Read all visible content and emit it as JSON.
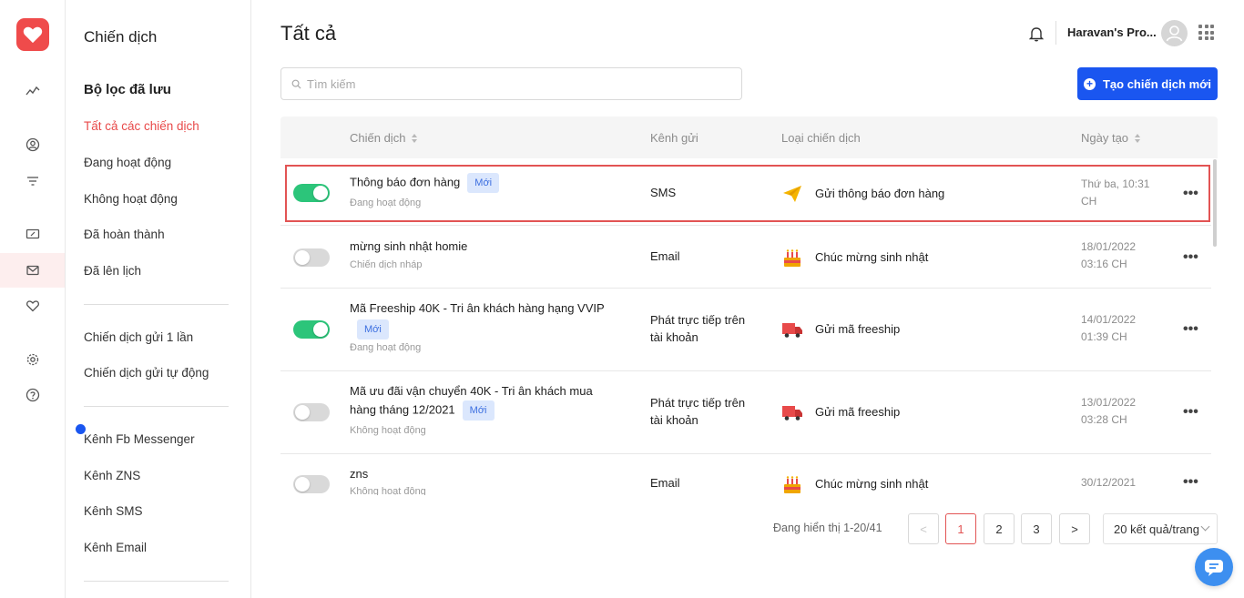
{
  "sidebar": {
    "title": "Chiến dịch",
    "saved_filters_heading": "Bộ lọc đã lưu",
    "filters": [
      "Tất cả các chiến dịch",
      "Đang hoạt động",
      "Không hoạt động",
      "Đã hoàn thành",
      "Đã lên lịch"
    ],
    "send_types": [
      "Chiến dịch gửi 1 lần",
      "Chiến dịch gửi tự động"
    ],
    "channels": [
      "Kênh Fb Messenger",
      "Kênh ZNS",
      "Kênh SMS",
      "Kênh Email"
    ]
  },
  "header": {
    "title": "Tất cả",
    "store_name": "Haravan's Pro..."
  },
  "search": {
    "placeholder": "Tìm kiếm"
  },
  "create_button": {
    "label": "Tạo chiến dịch mới"
  },
  "table": {
    "columns": [
      "Chiến dịch",
      "Kênh gửi",
      "Loại chiến dịch",
      "Ngày tạo"
    ],
    "rows": [
      {
        "name": "Thông báo đơn hàng",
        "badge": "Mới",
        "status": "Đang hoạt động",
        "enabled": true,
        "channel": "SMS",
        "type": "Gửi thông báo đơn hàng",
        "type_icon": "paper-plane-icon",
        "date_line1": "Thứ ba, 10:31",
        "date_line2": "CH"
      },
      {
        "name": "mừng sinh nhật homie",
        "badge": "",
        "status": "Chiến dịch nháp",
        "enabled": false,
        "channel": "Email",
        "type": "Chúc mừng sinh nhật",
        "type_icon": "birthday-cake-icon",
        "date_line1": "18/01/2022",
        "date_line2": "03:16 CH"
      },
      {
        "name": "Mã Freeship 40K - Tri ân khách hàng hạng VVIP",
        "badge": "Mới",
        "status": "Đang hoạt động",
        "enabled": true,
        "channel": "Phát trực tiếp trên tài khoản",
        "type": "Gửi mã freeship",
        "type_icon": "delivery-truck-icon",
        "date_line1": "14/01/2022",
        "date_line2": "01:39 CH"
      },
      {
        "name": "Mã ưu đãi vận chuyển 40K - Tri ân khách mua hàng tháng 12/2021",
        "badge": "Mới",
        "status": "Không hoạt động",
        "enabled": false,
        "channel": "Phát trực tiếp trên tài khoản",
        "type": "Gửi mã freeship",
        "type_icon": "delivery-truck-icon",
        "date_line1": "13/01/2022",
        "date_line2": "03:28 CH"
      },
      {
        "name": "zns",
        "badge": "",
        "status": "Không hoạt động",
        "enabled": false,
        "channel": "Email",
        "type": "Chúc mừng sinh nhật",
        "type_icon": "birthday-cake-icon",
        "date_line1": "30/12/2021",
        "date_line2": ""
      }
    ],
    "more_label": "•••"
  },
  "pagination": {
    "info": "Đang hiển thị 1-20/41",
    "prev": "<",
    "pages": [
      "1",
      "2",
      "3"
    ],
    "current_page": "1",
    "next": ">",
    "page_size": "20 kết quả/trang"
  },
  "colors": {
    "accent": "#1a56f0",
    "brand": "#ef4b4b",
    "active_toggle": "#2cc57a",
    "highlight_border": "#e25454"
  }
}
